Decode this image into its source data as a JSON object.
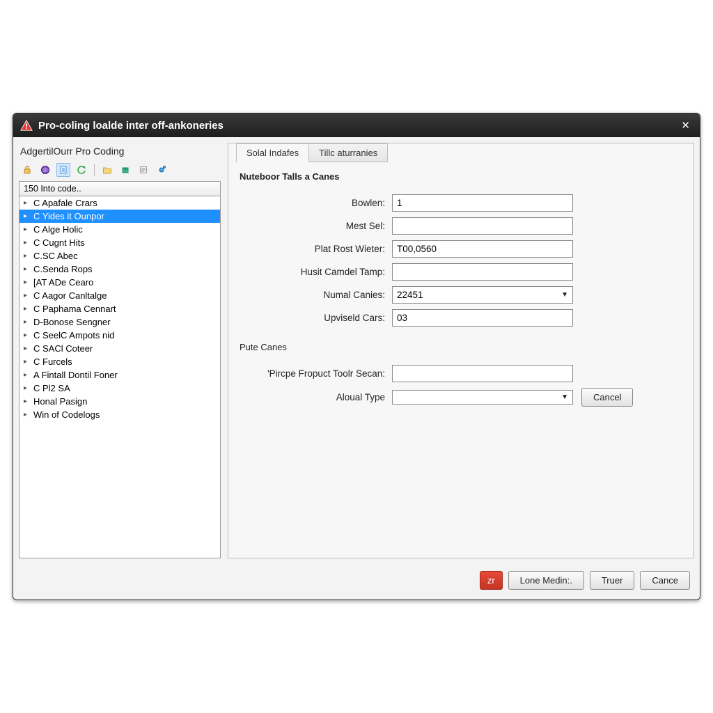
{
  "window": {
    "title": "Pro-coling loalde inter off-ankoneries"
  },
  "left": {
    "heading": "AdgertilOurr Pro Coding",
    "search": "150 Into code..",
    "items": [
      "C Apafale Crars",
      "C Yides it Ounpor",
      "C Alge Holic",
      "C Cugnt Hits",
      "C.SC Abec",
      "C.Senda Rops",
      "[AT ADe Cearo",
      "C Aagor Canltalge",
      "C Paphama Cennart",
      "D-Bonose Sengner",
      "C SeelC Ampots nid",
      "C SACl Coteer",
      "C Furcels",
      "A Fintall Dontil Foner",
      "C Pl2 SA",
      "Honal Pasign",
      "Win of Codelogs"
    ],
    "selected_index": 1
  },
  "tabs": [
    {
      "label": "Solal Indafes",
      "active": true
    },
    {
      "label": "Tillc aturranies",
      "active": false
    }
  ],
  "section1": {
    "title": "Nuteboor Talls a Canes",
    "fields": {
      "bowlen_label": "Bowlen:",
      "bowlen_value": "1",
      "mest_label": "Mest Sel:",
      "mest_value": "",
      "plat_label": "Plat Rost Wieter:",
      "plat_value": "T00,0560",
      "husit_label": "Husit Camdel Tamp:",
      "husit_value": "",
      "numal_label": "Numal Canies:",
      "numal_value": "22451",
      "upviseld_label": "Upviseld Cars:",
      "upviseld_value": "03"
    }
  },
  "section2": {
    "title": "Pute Canes",
    "fields": {
      "pircpe_label": "'Pircpe Fropuct Toolr Secan:",
      "pircpe_value": "",
      "aloual_label": "Aloual Type",
      "aloual_value": ""
    },
    "inline_cancel": "Cancel"
  },
  "footer": {
    "red_label": "zr",
    "btn1": "Lone Medin:.",
    "btn2": "Truer",
    "btn3": "Cance"
  }
}
